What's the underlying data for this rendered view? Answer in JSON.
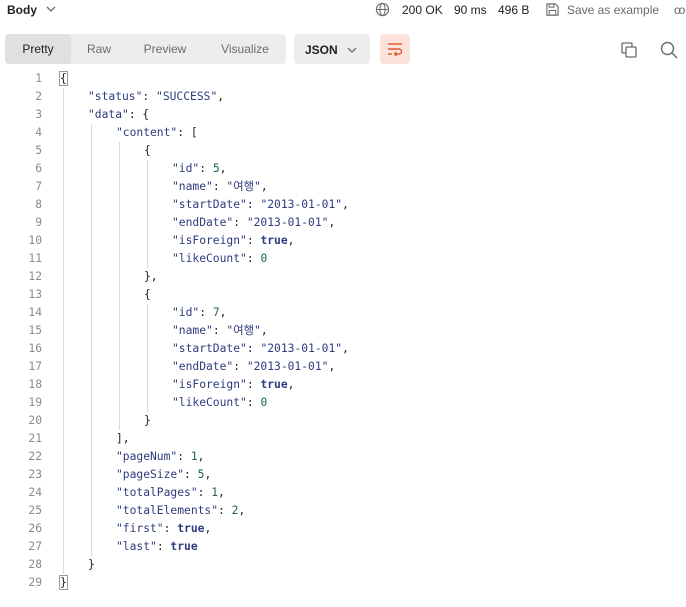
{
  "topbar": {
    "body_label": "Body",
    "status_code": "200 OK",
    "time": "90 ms",
    "size": "496 B",
    "save_label": "Save as example",
    "more_label": "oo"
  },
  "toolbar": {
    "tabs": [
      "Pretty",
      "Raw",
      "Preview",
      "Visualize"
    ],
    "active_tab": "Pretty",
    "format": "JSON"
  },
  "colors": {
    "accent_wrap": "#fbe3dc",
    "wrap_icon": "#e0562f",
    "key": "#2e3b7d",
    "number": "#1a6a3a"
  },
  "response_lines": [
    "{",
    "\"status\": \"SUCCESS\",",
    "\"data\": {",
    "\"content\": [",
    "{",
    "\"id\": 5,",
    "\"name\": \"여행\",",
    "\"startDate\": \"2013-01-01\",",
    "\"endDate\": \"2013-01-01\",",
    "\"isForeign\": true,",
    "\"likeCount\": 0",
    "},",
    "{",
    "\"id\": 7,",
    "\"name\": \"여행\",",
    "\"startDate\": \"2013-01-01\",",
    "\"endDate\": \"2013-01-01\",",
    "\"isForeign\": true,",
    "\"likeCount\": 0",
    "}",
    "],",
    "\"pageNum\": 1,",
    "\"pageSize\": 5,",
    "\"totalPages\": 1,",
    "\"totalElements\": 2,",
    "\"first\": true,",
    "\"last\": true",
    "}",
    "}"
  ],
  "line_numbers": [
    "1",
    "2",
    "3",
    "4",
    "5",
    "6",
    "7",
    "8",
    "9",
    "10",
    "11",
    "12",
    "13",
    "14",
    "15",
    "16",
    "17",
    "18",
    "19",
    "20",
    "21",
    "22",
    "23",
    "24",
    "25",
    "26",
    "27",
    "28",
    "29"
  ]
}
